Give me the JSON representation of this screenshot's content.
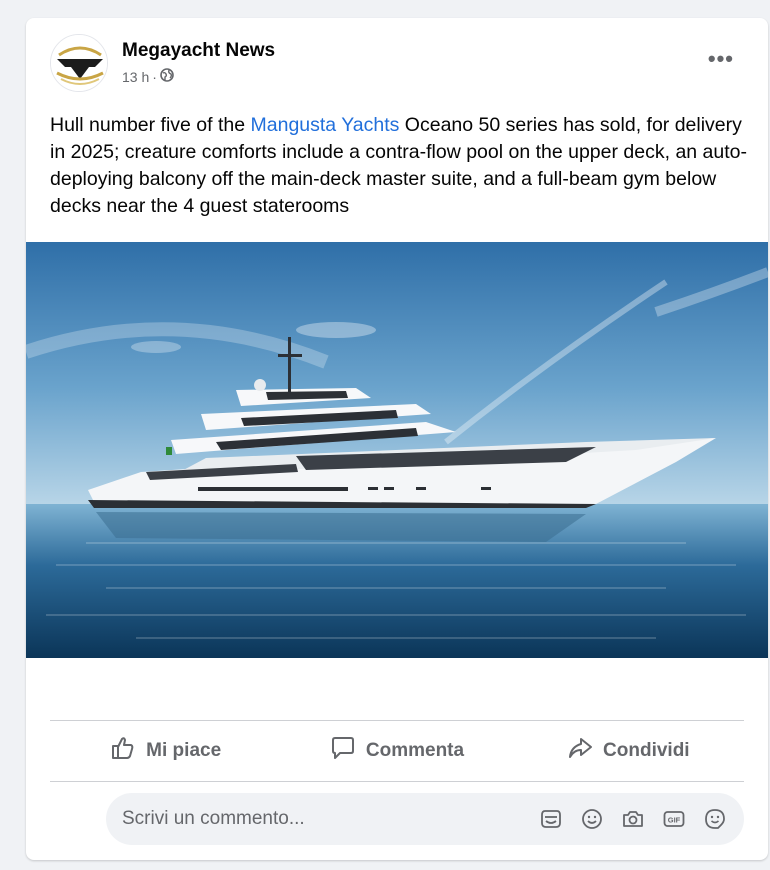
{
  "post": {
    "page_name": "Megayacht News",
    "time": "13 h",
    "separator": "·",
    "privacy_icon": "globe-icon",
    "more_label": "•••",
    "text_before_link": "Hull number five of the ",
    "link_text": "Mangusta Yachts",
    "text_after_link": " Oceano 50 series has sold, for delivery in 2025; creature comforts include a contra-flow pool on the upper deck, an auto-deploying balcony off the main-deck master suite, and a full-beam gym below decks near the 4 guest staterooms",
    "image_subject": "yacht-photo"
  },
  "actions": {
    "like_label": "Mi piace",
    "comment_label": "Commenta",
    "share_label": "Condividi"
  },
  "comment": {
    "placeholder": "Scrivi un commento...",
    "icons": [
      "avatar-sticker-icon",
      "emoji-icon",
      "camera-icon",
      "gif-icon",
      "sticker-icon"
    ]
  },
  "colors": {
    "link": "#216fdb",
    "secondary_text": "#65676b",
    "background": "#f0f2f5"
  }
}
